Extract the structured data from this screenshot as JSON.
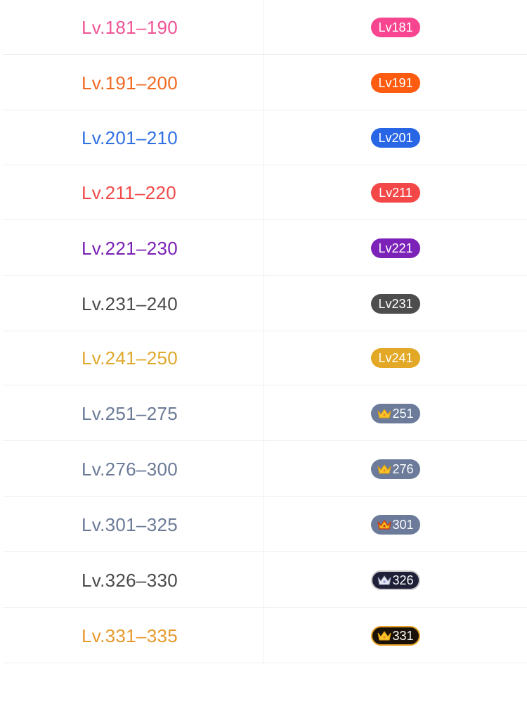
{
  "rows": [
    {
      "range": "Lv.181–190",
      "badge": "Lv181",
      "text_color": "#f05495",
      "badge_color": "#f7468f",
      "crown": ""
    },
    {
      "range": "Lv.191–200",
      "badge": "Lv191",
      "text_color": "#f26a21",
      "badge_color": "#fc5b10",
      "crown": ""
    },
    {
      "range": "Lv.201–210",
      "badge": "Lv201",
      "text_color": "#2f6fe4",
      "badge_color": "#2866e6",
      "crown": ""
    },
    {
      "range": "Lv.211–220",
      "badge": "Lv211",
      "text_color": "#f14a4a",
      "badge_color": "#f44848",
      "crown": ""
    },
    {
      "range": "Lv.221–230",
      "badge": "Lv221",
      "text_color": "#7a1fb5",
      "badge_color": "#7c22b8",
      "crown": ""
    },
    {
      "range": "Lv.231–240",
      "badge": "Lv231",
      "text_color": "#4a4a4a",
      "badge_color": "#4d4d4d",
      "crown": ""
    },
    {
      "range": "Lv.241–250",
      "badge": "Lv241",
      "text_color": "#e0a82c",
      "badge_color": "#e2a826",
      "crown": ""
    },
    {
      "range": "Lv.251–275",
      "badge": "251",
      "text_color": "#6b7a97",
      "badge_color": "#6b7b99",
      "crown": "gold-crown-icon"
    },
    {
      "range": "Lv.276–300",
      "badge": "276",
      "text_color": "#6b7a97",
      "badge_color": "#6b7b99",
      "crown": "gold-crown-icon"
    },
    {
      "range": "Lv.301–325",
      "badge": "301",
      "text_color": "#6b7a97",
      "badge_color": "#6b7b99",
      "crown": "red-gold-crown-icon"
    },
    {
      "range": "Lv.326–330",
      "badge": "326",
      "text_color": "#4a4a4a",
      "badge_color": "#1f2038",
      "crown": "silver-crown-icon"
    },
    {
      "range": "Lv.331–335",
      "badge": "331",
      "text_color": "#e79a2c",
      "badge_color": "#1a1208",
      "crown": "gold-crown-icon"
    }
  ]
}
